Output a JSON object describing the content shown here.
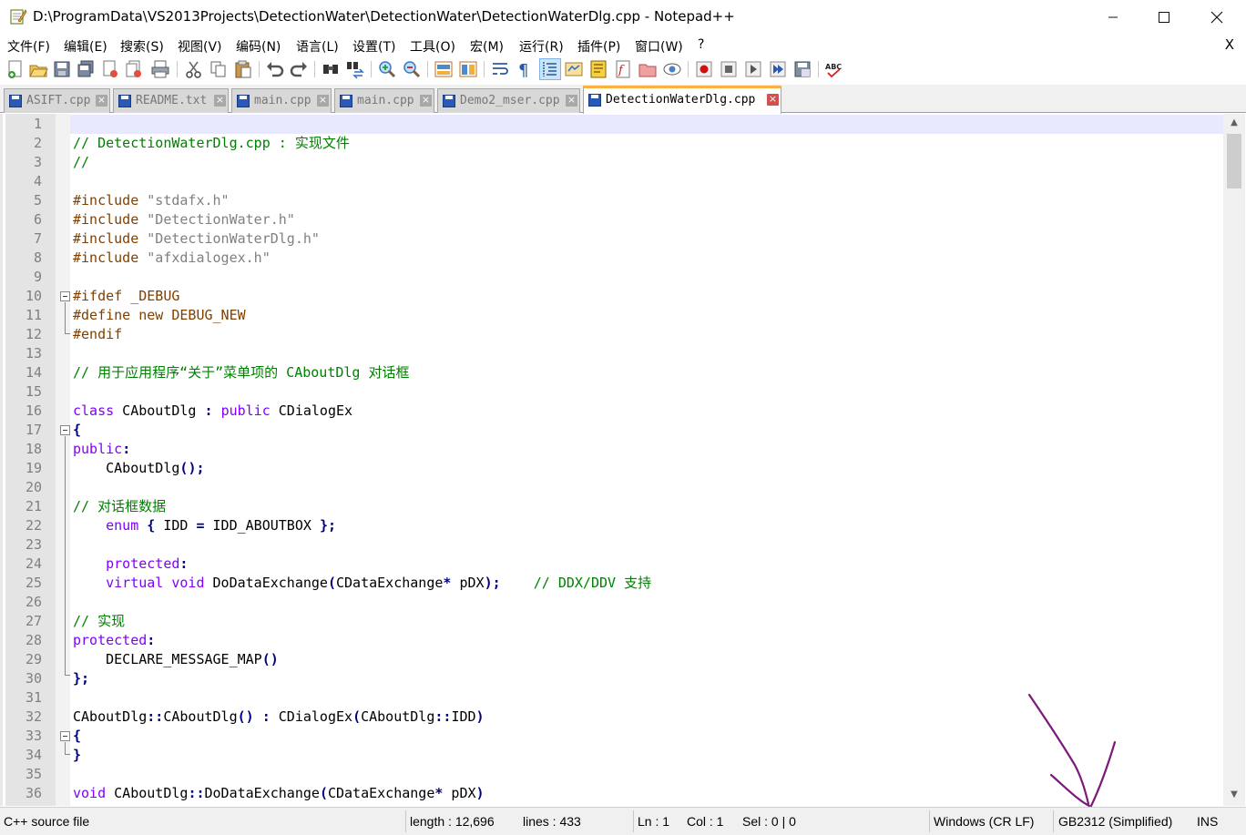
{
  "window": {
    "title": "D:\\ProgramData\\VS2013Projects\\DetectionWater\\DetectionWater\\DetectionWaterDlg.cpp - Notepad++"
  },
  "menu": [
    "文件(F)",
    "编辑(E)",
    "搜索(S)",
    "视图(V)",
    "编码(N)",
    "语言(L)",
    "设置(T)",
    "工具(O)",
    "宏(M)",
    "运行(R)",
    "插件(P)",
    "窗口(W)",
    "?"
  ],
  "menu_close": "X",
  "tabs": [
    {
      "label": "ASIFT.cpp"
    },
    {
      "label": "README.txt"
    },
    {
      "label": "main.cpp"
    },
    {
      "label": "main.cpp"
    },
    {
      "label": "Demo2_mser.cpp"
    },
    {
      "label": "DetectionWaterDlg.cpp"
    }
  ],
  "tab_close": "×",
  "lines": [
    {
      "n": "1",
      "t": ""
    },
    {
      "n": "2",
      "t": "// DetectionWaterDlg.cpp : 实现文件"
    },
    {
      "n": "3",
      "t": "//"
    },
    {
      "n": "4",
      "t": ""
    },
    {
      "n": "5",
      "t": "#include \"stdafx.h\""
    },
    {
      "n": "6",
      "t": "#include \"DetectionWater.h\""
    },
    {
      "n": "7",
      "t": "#include \"DetectionWaterDlg.h\""
    },
    {
      "n": "8",
      "t": "#include \"afxdialogex.h\""
    },
    {
      "n": "9",
      "t": ""
    },
    {
      "n": "10",
      "t": "#ifdef _DEBUG"
    },
    {
      "n": "11",
      "t": "#define new DEBUG_NEW"
    },
    {
      "n": "12",
      "t": "#endif"
    },
    {
      "n": "13",
      "t": ""
    },
    {
      "n": "14",
      "t": "// 用于应用程序“关于”菜单项的 CAboutDlg 对话框"
    },
    {
      "n": "15",
      "t": ""
    },
    {
      "n": "16",
      "t": "class CAboutDlg : public CDialogEx"
    },
    {
      "n": "17",
      "t": "{"
    },
    {
      "n": "18",
      "t": "public:"
    },
    {
      "n": "19",
      "t": "    CAboutDlg();"
    },
    {
      "n": "20",
      "t": ""
    },
    {
      "n": "21",
      "t": "// 对话框数据"
    },
    {
      "n": "22",
      "t": "    enum { IDD = IDD_ABOUTBOX };"
    },
    {
      "n": "23",
      "t": ""
    },
    {
      "n": "24",
      "t": "    protected:"
    },
    {
      "n": "25",
      "t": "    virtual void DoDataExchange(CDataExchange* pDX);    // DDX/DDV 支持"
    },
    {
      "n": "26",
      "t": ""
    },
    {
      "n": "27",
      "t": "// 实现"
    },
    {
      "n": "28",
      "t": "protected:"
    },
    {
      "n": "29",
      "t": "    DECLARE_MESSAGE_MAP()"
    },
    {
      "n": "30",
      "t": "};"
    },
    {
      "n": "31",
      "t": ""
    },
    {
      "n": "32",
      "t": "CAboutDlg::CAboutDlg() : CDialogEx(CAboutDlg::IDD)"
    },
    {
      "n": "33",
      "t": "{"
    },
    {
      "n": "34",
      "t": "}"
    },
    {
      "n": "35",
      "t": ""
    },
    {
      "n": "36",
      "t": "void CAboutDlg::DoDataExchange(CDataExchange* pDX)"
    }
  ],
  "status": {
    "file_type": "C++ source file",
    "length": "length : 12,696",
    "lines": "lines : 433",
    "ln": "Ln : 1",
    "col": "Col : 1",
    "sel": "Sel : 0 | 0",
    "eol": "Windows (CR LF)",
    "encoding": "GB2312 (Simplified)",
    "mode": "INS"
  },
  "colors": {
    "comment": "#008000",
    "preprocessor": "#804000",
    "keyword": "#8000ff",
    "current_line": "#e8e8ff",
    "active_tab_accent": "#fab342",
    "annotation_arrow": "#7a1a7a"
  }
}
